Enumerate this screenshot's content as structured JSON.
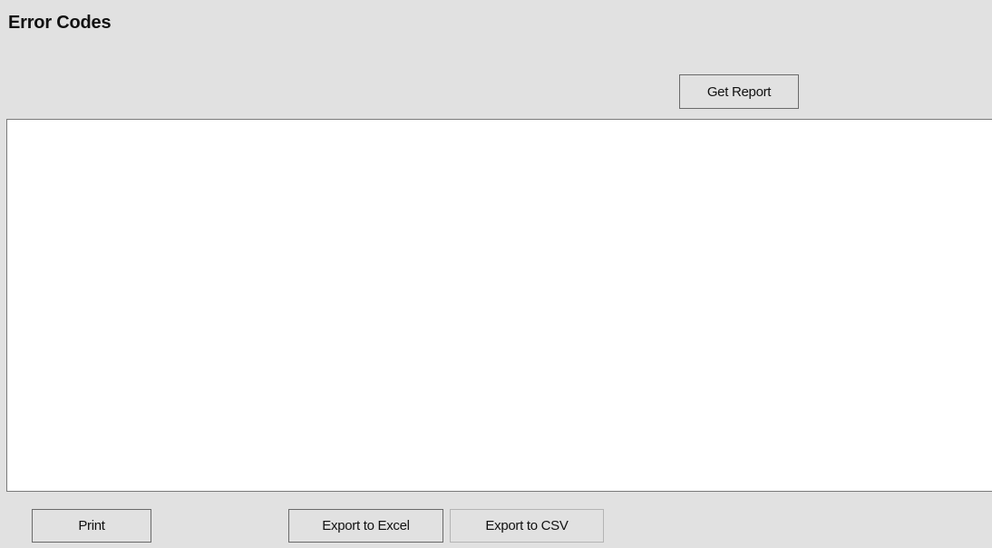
{
  "header": {
    "title": "Error Codes",
    "get_report_label": "Get Report"
  },
  "report": {
    "content": ""
  },
  "footer": {
    "print_label": "Print",
    "export_excel_label": "Export to Excel",
    "export_csv_label": "Export to CSV"
  },
  "colors": {
    "panel_background": "#e1e1e1",
    "report_background": "#ffffff",
    "button_border": "#6a6a6a"
  }
}
